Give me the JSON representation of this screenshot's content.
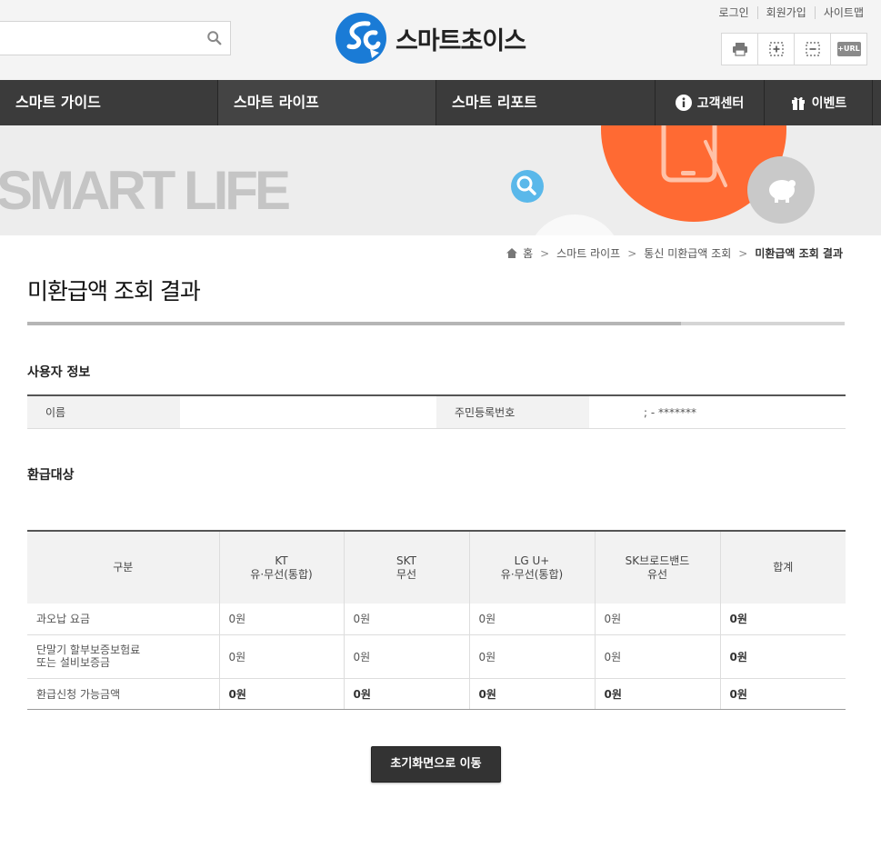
{
  "header": {
    "brand": "스마트초이스",
    "search": {
      "placeholder": ""
    },
    "top_links": [
      "로그인",
      "회원가입",
      "사이트맵"
    ],
    "tools": [
      "print-icon",
      "zoom-in-icon",
      "zoom-out-icon",
      "url-copy-icon"
    ],
    "tool_url_text": "+URL"
  },
  "nav": {
    "items": [
      "스마트 가이드",
      "스마트 라이프",
      "스마트 리포트"
    ],
    "customer_center": "고객센터",
    "event": "이벤트"
  },
  "banner": {
    "text": "SMART LIFE"
  },
  "breadcrumb": [
    "홈",
    "스마트 라이프",
    "통신 미환급액 조회",
    "미환급액 조회 결과"
  ],
  "page_title": "미환급액 조회 결과",
  "progress_fraction": 0.8,
  "user_info": {
    "section_title": "사용자 정보",
    "name_label": "이름",
    "name_value": "",
    "rrn_label": "주민등록번호",
    "rrn_value": "; - *******"
  },
  "refund": {
    "section_title": "환급대상",
    "headers": [
      {
        "line1": "구분",
        "line2": ""
      },
      {
        "line1": "KT",
        "line2": "유·무선(통합)"
      },
      {
        "line1": "SKT",
        "line2": "무선"
      },
      {
        "line1": "LG U+",
        "line2": "유·무선(통합)"
      },
      {
        "line1": "SK브로드밴드",
        "line2": "유선"
      },
      {
        "line1": "합계",
        "line2": ""
      }
    ],
    "rows": [
      {
        "label1": "과오납 요금",
        "label2": "",
        "values": [
          "0원",
          "0원",
          "0원",
          "0원",
          "0원"
        ]
      },
      {
        "label1": "단말기 할부보증보험료",
        "label2": "또는 설비보증금",
        "values": [
          "0원",
          "0원",
          "0원",
          "0원",
          "0원"
        ]
      },
      {
        "label1": "환급신청 가능금액",
        "label2": "",
        "values": [
          "0원",
          "0원",
          "0원",
          "0원",
          "0원"
        ]
      }
    ]
  },
  "home_button": "초기화면으로 이동",
  "colors": {
    "nav": "#3b3b3b",
    "brand_blue": "#1a7bd6",
    "banner_orange": "#ff6a33"
  }
}
